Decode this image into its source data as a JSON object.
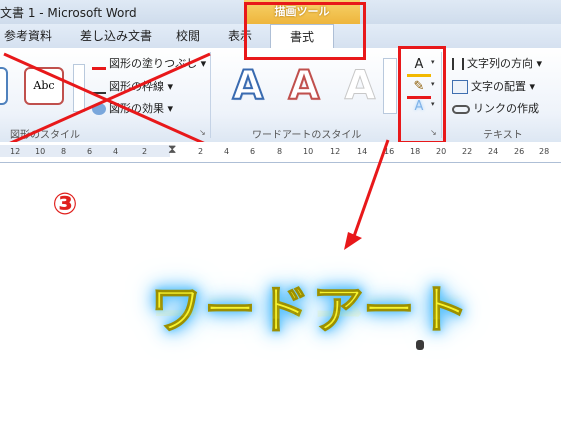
{
  "window": {
    "title": "文書 1 - Microsoft Word",
    "contextual_tab": "描画ツール"
  },
  "tabs": [
    "参考資料",
    "差し込み文書",
    "校閲",
    "表示",
    "書式"
  ],
  "shape_styles": {
    "abc_label": "Abc",
    "fill": "図形の塗りつぶし",
    "outline": "図形の枠線",
    "effects": "図形の効果",
    "group_label": "図形のスタイル"
  },
  "wordart_styles": {
    "sample": "A",
    "group_label": "ワードアートのスタイル"
  },
  "text_group": {
    "text_direction": "文字列の方向",
    "align_text": "文字の配置",
    "create_link": "リンクの作成",
    "group_label": "テキスト"
  },
  "ruler_ticks": [
    "12",
    "10",
    "8",
    "6",
    "4",
    "2",
    "2",
    "4",
    "6",
    "8",
    "10",
    "12",
    "14",
    "16",
    "18",
    "20",
    "22",
    "24",
    "26",
    "28"
  ],
  "document": {
    "step_marker": "③",
    "wordart_text": "ワードアート"
  },
  "colors": {
    "annotation_red": "#e8181a",
    "wordart_fill": "#f7f430",
    "wordart_glow": "#45b9ff"
  }
}
